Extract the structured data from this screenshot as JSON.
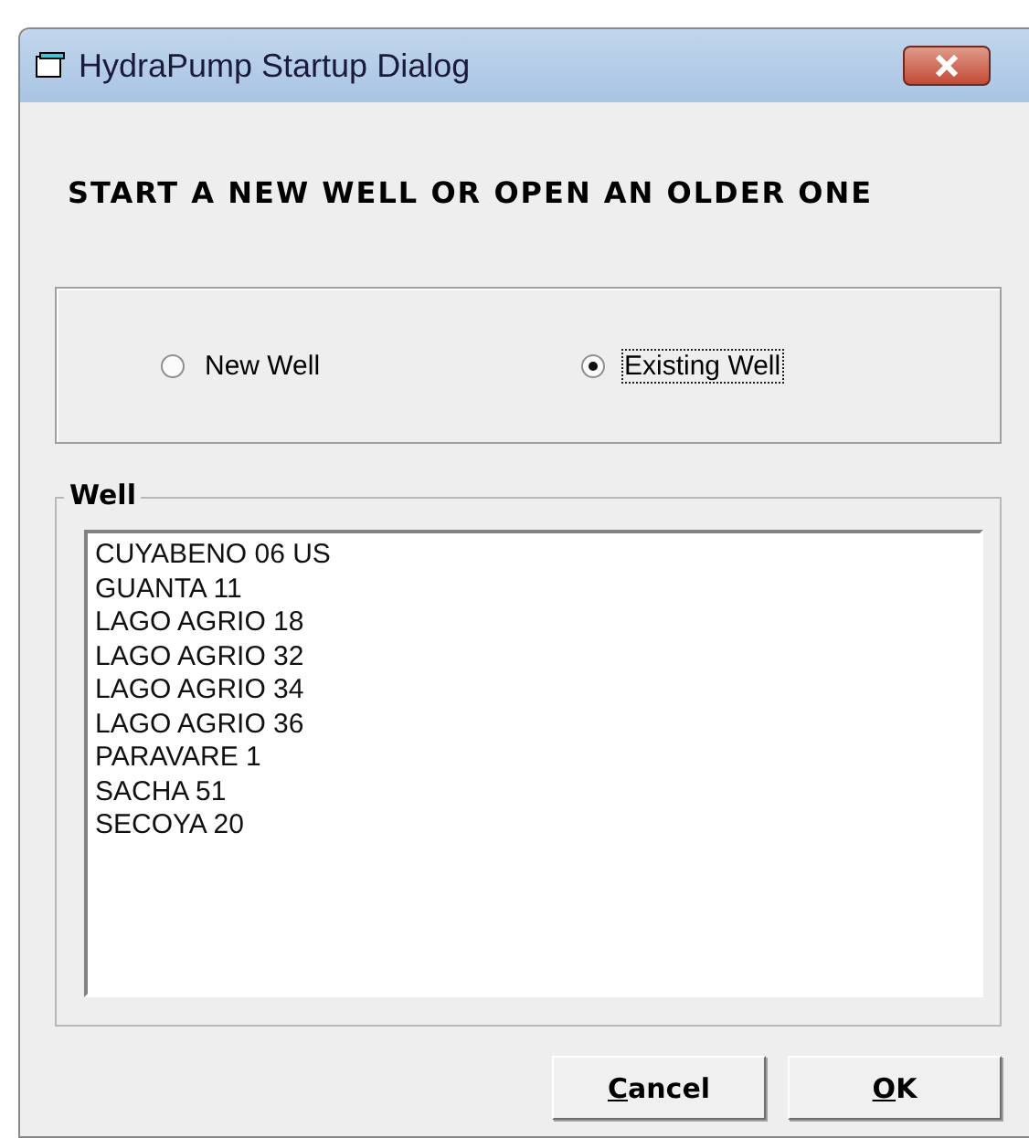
{
  "window": {
    "title": "HydraPump Startup Dialog"
  },
  "heading": "START A NEW WELL OR OPEN AN OLDER ONE",
  "options": [
    {
      "label": "New Well",
      "selected": false
    },
    {
      "label": "Existing Well",
      "selected": true
    }
  ],
  "well_group": {
    "title": "Well",
    "items": [
      "CUYABENO 06 US",
      "GUANTA 11",
      "LAGO AGRIO 18",
      "LAGO AGRIO 32",
      "LAGO AGRIO 34",
      "LAGO AGRIO 36",
      "PARAVARE 1",
      "SACHA 51",
      "SECOYA 20"
    ]
  },
  "buttons": [
    "Cancel",
    "OK"
  ]
}
